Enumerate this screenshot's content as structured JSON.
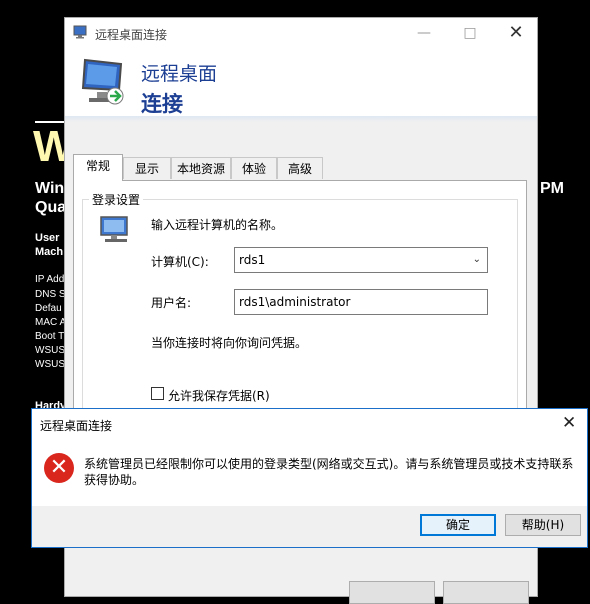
{
  "desktop": {
    "big_letter": "W",
    "line1": "Win",
    "line2": "Qua",
    "line1_right": "PM",
    "user_label": "User",
    "machine_label": "Mach",
    "info_labels": [
      "IP Add",
      "DNS S",
      "Defau",
      "MAC A",
      "Boot T",
      "WSUS",
      "WSUS"
    ],
    "hardware_label": "Hardy"
  },
  "rdp_window": {
    "title": "远程桌面连接",
    "min_icon": "minimize-icon",
    "max_icon": "maximize-icon",
    "close_icon": "close-icon",
    "header_line1": "远程桌面",
    "header_line2": "连接",
    "tabs": [
      {
        "label": "常规",
        "active": true
      },
      {
        "label": "显示",
        "active": false
      },
      {
        "label": "本地资源",
        "active": false
      },
      {
        "label": "体验",
        "active": false
      },
      {
        "label": "高级",
        "active": false
      }
    ],
    "login_group": {
      "title": "登录设置",
      "instruction": "输入远程计算机的名称。",
      "computer_label": "计算机(C):",
      "computer_value": "rds1",
      "username_label": "用户名:",
      "username_value": "rds1\\administrator",
      "prompt_text": "当你连接时将向你询问凭据。",
      "save_credentials_label": "允许我保存凭据(R)",
      "save_credentials_checked": false
    }
  },
  "error_dialog": {
    "title": "远程桌面连接",
    "close_icon": "close-icon",
    "icon": "error-icon",
    "message": "系统管理员已经限制你可以使用的登录类型(网络或交互式)。请与系统管理员或技术支持联系获得协助。",
    "ok_label": "确定",
    "help_label": "帮助(H)"
  }
}
